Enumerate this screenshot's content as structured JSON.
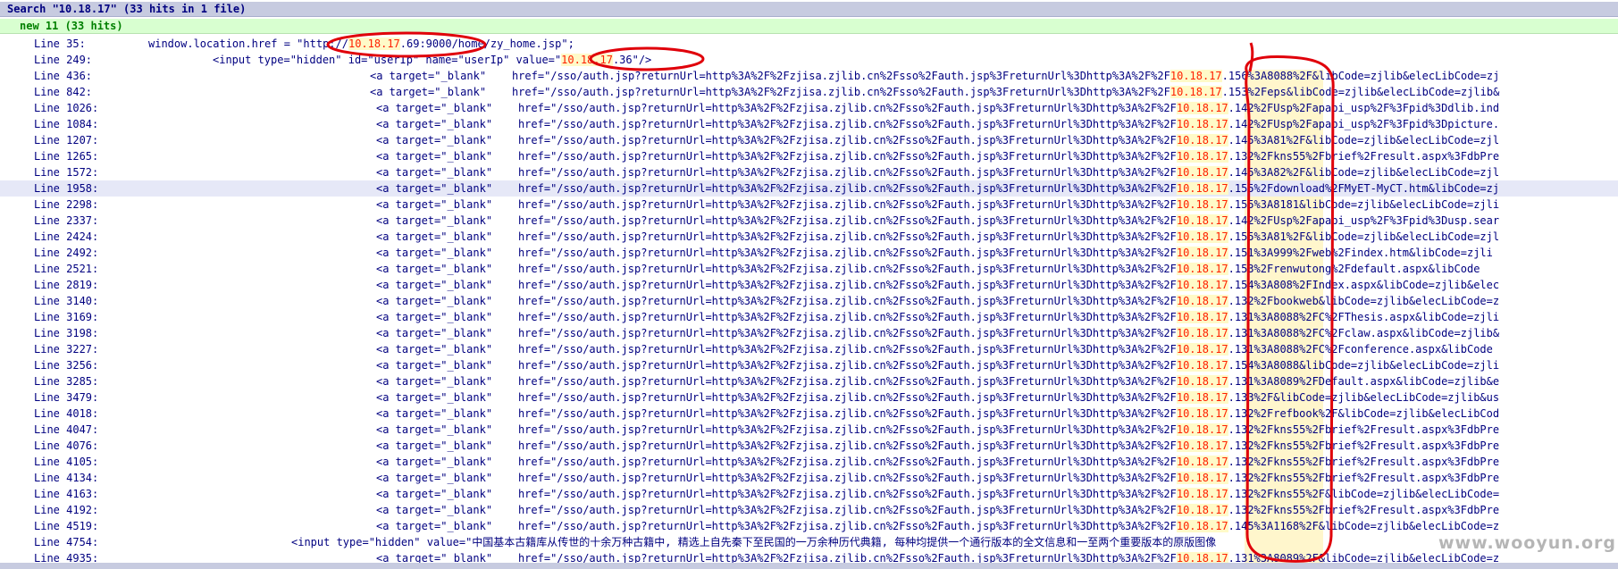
{
  "search_header": "Search \"10.18.17\" (33 hits in 1 file)",
  "file_entry": "new  11 (33 hits)",
  "search_term": "10.18.17",
  "colors": {
    "match": "#ff2000",
    "match_bg": "#fffac8",
    "header_bg": "#c7cbe0",
    "file_bg": "#d8ffd0",
    "text": "#000080"
  },
  "hits": [
    {
      "line": "Line 35:",
      "code": "window.location.href = \"http://10.18.17.69:9000/home/zy_home.jsp\";"
    },
    {
      "line": "Line 249:",
      "code": "<input type=\"hidden\" id=\"userIp\" name=\"userIp\" value=\"10.18.17.36\"/>"
    },
    {
      "line": "Line 436:",
      "code": "<a target=\"_blank\"    href=\"/sso/auth.jsp?returnUrl=http%3A%2F%2Fzjisa.zjlib.cn%2Fsso%2Fauth.jsp%3FreturnUrl%3Dhttp%3A%2F%2F10.18.17.156%3A8088%2F&libCode=zjlib&elecLibCode=zj"
    },
    {
      "line": "Line 842:",
      "code": "<a target=\"_blank\"    href=\"/sso/auth.jsp?returnUrl=http%3A%2F%2Fzjisa.zjlib.cn%2Fsso%2Fauth.jsp%3FreturnUrl%3Dhttp%3A%2F%2F10.18.17.153%2Feps&libCode=zjlib&elecLibCode=zjlib&"
    },
    {
      "line": "Line 1026:",
      "code": "<a target=\"_blank\"    href=\"/sso/auth.jsp?returnUrl=http%3A%2F%2Fzjisa.zjlib.cn%2Fsso%2Fauth.jsp%3FreturnUrl%3Dhttp%3A%2F%2F10.18.17.142%2FUsp%2Fapabi_usp%2F%3Fpid%3Ddlib.ind"
    },
    {
      "line": "Line 1084:",
      "code": "<a target=\"_blank\"    href=\"/sso/auth.jsp?returnUrl=http%3A%2F%2Fzjisa.zjlib.cn%2Fsso%2Fauth.jsp%3FreturnUrl%3Dhttp%3A%2F%2F10.18.17.142%2FUsp%2Fapabi_usp%2F%3Fpid%3Dpicture."
    },
    {
      "line": "Line 1207:",
      "code": "<a target=\"_blank\"    href=\"/sso/auth.jsp?returnUrl=http%3A%2F%2Fzjisa.zjlib.cn%2Fsso%2Fauth.jsp%3FreturnUrl%3Dhttp%3A%2F%2F10.18.17.145%3A81%2F&libCode=zjlib&elecLibCode=zjl"
    },
    {
      "line": "Line 1265:",
      "code": "<a target=\"_blank\"    href=\"/sso/auth.jsp?returnUrl=http%3A%2F%2Fzjisa.zjlib.cn%2Fsso%2Fauth.jsp%3FreturnUrl%3Dhttp%3A%2F%2F10.18.17.132%2Fkns55%2Fbrief%2Fresult.aspx%3FdbPre"
    },
    {
      "line": "Line 1572:",
      "code": "<a target=\"_blank\"    href=\"/sso/auth.jsp?returnUrl=http%3A%2F%2Fzjisa.zjlib.cn%2Fsso%2Fauth.jsp%3FreturnUrl%3Dhttp%3A%2F%2F10.18.17.145%3A82%2F&libCode=zjlib&elecLibCode=zjl"
    },
    {
      "line": "Line 1958:",
      "code": "<a target=\"_blank\"    href=\"/sso/auth.jsp?returnUrl=http%3A%2F%2Fzjisa.zjlib.cn%2Fsso%2Fauth.jsp%3FreturnUrl%3Dhttp%3A%2F%2F10.18.17.155%2Fdownload%2FMyET-MyCT.htm&libCode=zj"
    },
    {
      "line": "Line 2298:",
      "code": "<a target=\"_blank\"    href=\"/sso/auth.jsp?returnUrl=http%3A%2F%2Fzjisa.zjlib.cn%2Fsso%2Fauth.jsp%3FreturnUrl%3Dhttp%3A%2F%2F10.18.17.155%3A8181&libCode=zjlib&elecLibCode=zjli"
    },
    {
      "line": "Line 2337:",
      "code": "<a target=\"_blank\"    href=\"/sso/auth.jsp?returnUrl=http%3A%2F%2Fzjisa.zjlib.cn%2Fsso%2Fauth.jsp%3FreturnUrl%3Dhttp%3A%2F%2F10.18.17.142%2FUsp%2Fapabi_usp%2F%3Fpid%3Dusp.sear"
    },
    {
      "line": "Line 2424:",
      "code": "<a target=\"_blank\"    href=\"/sso/auth.jsp?returnUrl=http%3A%2F%2Fzjisa.zjlib.cn%2Fsso%2Fauth.jsp%3FreturnUrl%3Dhttp%3A%2F%2F10.18.17.155%3A81%2F&libCode=zjlib&elecLibCode=zjl"
    },
    {
      "line": "Line 2492:",
      "code": "<a target=\"_blank\"    href=\"/sso/auth.jsp?returnUrl=http%3A%2F%2Fzjisa.zjlib.cn%2Fsso%2Fauth.jsp%3FreturnUrl%3Dhttp%3A%2F%2F10.18.17.151%3A999%2Fweb%2Findex.htm&libCode=zjli"
    },
    {
      "line": "Line 2521:",
      "code": "<a target=\"_blank\"    href=\"/sso/auth.jsp?returnUrl=http%3A%2F%2Fzjisa.zjlib.cn%2Fsso%2Fauth.jsp%3FreturnUrl%3Dhttp%3A%2F%2F10.18.17.153%2Frenwutong%2Fdefault.aspx&libCode"
    },
    {
      "line": "Line 2819:",
      "code": "<a target=\"_blank\"    href=\"/sso/auth.jsp?returnUrl=http%3A%2F%2Fzjisa.zjlib.cn%2Fsso%2Fauth.jsp%3FreturnUrl%3Dhttp%3A%2F%2F10.18.17.154%3A808%2FIndex.aspx&libCode=zjlib&elec"
    },
    {
      "line": "Line 3140:",
      "code": "<a target=\"_blank\"    href=\"/sso/auth.jsp?returnUrl=http%3A%2F%2Fzjisa.zjlib.cn%2Fsso%2Fauth.jsp%3FreturnUrl%3Dhttp%3A%2F%2F10.18.17.132%2Fbookweb&libCode=zjlib&elecLibCode=z"
    },
    {
      "line": "Line 3169:",
      "code": "<a target=\"_blank\"    href=\"/sso/auth.jsp?returnUrl=http%3A%2F%2Fzjisa.zjlib.cn%2Fsso%2Fauth.jsp%3FreturnUrl%3Dhttp%3A%2F%2F10.18.17.131%3A8088%2FC%2FThesis.aspx&libCode=zjli"
    },
    {
      "line": "Line 3198:",
      "code": "<a target=\"_blank\"    href=\"/sso/auth.jsp?returnUrl=http%3A%2F%2Fzjisa.zjlib.cn%2Fsso%2Fauth.jsp%3FreturnUrl%3Dhttp%3A%2F%2F10.18.17.131%3A8088%2FC%2Fclaw.aspx&libCode=zjlib&"
    },
    {
      "line": "Line 3227:",
      "code": "<a target=\"_blank\"    href=\"/sso/auth.jsp?returnUrl=http%3A%2F%2Fzjisa.zjlib.cn%2Fsso%2Fauth.jsp%3FreturnUrl%3Dhttp%3A%2F%2F10.18.17.131%3A8088%2FC%2Fconference.aspx&libCode"
    },
    {
      "line": "Line 3256:",
      "code": "<a target=\"_blank\"    href=\"/sso/auth.jsp?returnUrl=http%3A%2F%2Fzjisa.zjlib.cn%2Fsso%2Fauth.jsp%3FreturnUrl%3Dhttp%3A%2F%2F10.18.17.154%3A8088&libCode=zjlib&elecLibCode=zjli"
    },
    {
      "line": "Line 3285:",
      "code": "<a target=\"_blank\"    href=\"/sso/auth.jsp?returnUrl=http%3A%2F%2Fzjisa.zjlib.cn%2Fsso%2Fauth.jsp%3FreturnUrl%3Dhttp%3A%2F%2F10.18.17.131%3A8089%2FDefault.aspx&libCode=zjlib&e"
    },
    {
      "line": "Line 3479:",
      "code": "<a target=\"_blank\"    href=\"/sso/auth.jsp?returnUrl=http%3A%2F%2Fzjisa.zjlib.cn%2Fsso%2Fauth.jsp%3FreturnUrl%3Dhttp%3A%2F%2F10.18.17.133%2F&libCode=zjlib&elecLibCode=zjlib&us"
    },
    {
      "line": "Line 4018:",
      "code": "<a target=\"_blank\"    href=\"/sso/auth.jsp?returnUrl=http%3A%2F%2Fzjisa.zjlib.cn%2Fsso%2Fauth.jsp%3FreturnUrl%3Dhttp%3A%2F%2F10.18.17.132%2Frefbook%2F&libCode=zjlib&elecLibCod"
    },
    {
      "line": "Line 4047:",
      "code": "<a target=\"_blank\"    href=\"/sso/auth.jsp?returnUrl=http%3A%2F%2Fzjisa.zjlib.cn%2Fsso%2Fauth.jsp%3FreturnUrl%3Dhttp%3A%2F%2F10.18.17.132%2Fkns55%2Fbrief%2Fresult.aspx%3FdbPre"
    },
    {
      "line": "Line 4076:",
      "code": "<a target=\"_blank\"    href=\"/sso/auth.jsp?returnUrl=http%3A%2F%2Fzjisa.zjlib.cn%2Fsso%2Fauth.jsp%3FreturnUrl%3Dhttp%3A%2F%2F10.18.17.132%2Fkns55%2Fbrief%2Fresult.aspx%3FdbPre"
    },
    {
      "line": "Line 4105:",
      "code": "<a target=\"_blank\"    href=\"/sso/auth.jsp?returnUrl=http%3A%2F%2Fzjisa.zjlib.cn%2Fsso%2Fauth.jsp%3FreturnUrl%3Dhttp%3A%2F%2F10.18.17.132%2Fkns55%2Fbrief%2Fresult.aspx%3FdbPre"
    },
    {
      "line": "Line 4134:",
      "code": "<a target=\"_blank\"    href=\"/sso/auth.jsp?returnUrl=http%3A%2F%2Fzjisa.zjlib.cn%2Fsso%2Fauth.jsp%3FreturnUrl%3Dhttp%3A%2F%2F10.18.17.132%2Fkns55%2Fbrief%2Fresult.aspx%3FdbPre"
    },
    {
      "line": "Line 4163:",
      "code": "<a target=\"_blank\"    href=\"/sso/auth.jsp?returnUrl=http%3A%2F%2Fzjisa.zjlib.cn%2Fsso%2Fauth.jsp%3FreturnUrl%3Dhttp%3A%2F%2F10.18.17.132%2Fkns55%2F&libCode=zjlib&elecLibCode="
    },
    {
      "line": "Line 4192:",
      "code": "<a target=\"_blank\"    href=\"/sso/auth.jsp?returnUrl=http%3A%2F%2Fzjisa.zjlib.cn%2Fsso%2Fauth.jsp%3FreturnUrl%3Dhttp%3A%2F%2F10.18.17.132%2Fkns55%2Fbrief%2Fresult.aspx%3FdbPre"
    },
    {
      "line": "Line 4519:",
      "code": "<a target=\"_blank\"    href=\"/sso/auth.jsp?returnUrl=http%3A%2F%2Fzjisa.zjlib.cn%2Fsso%2Fauth.jsp%3FreturnUrl%3Dhttp%3A%2F%2F10.18.17.145%3A1168%2F&libCode=zjlib&elecLibCode=z"
    },
    {
      "line": "Line 4754:",
      "code": "<input type=\"hidden\" value=\"中国基本古籍库从传世的十余万种古籍中, 精选上自先秦下至民国的一万余种历代典籍, 每种均提供一个通行版本的全文信息和一至两个重要版本的原版图像"
    },
    {
      "line": "Line 4935:",
      "code": "<a target=\"_blank\"    href=\"/sso/auth.jsp?returnUrl=http%3A%2F%2Fzjisa.zjlib.cn%2Fsso%2Fauth.jsp%3FreturnUrl%3Dhttp%3A%2F%2F10.18.17.131%3A8089%2F&libCode=zjlib&elecLibCode=z"
    }
  ],
  "watermark": "www.wooyun.org"
}
